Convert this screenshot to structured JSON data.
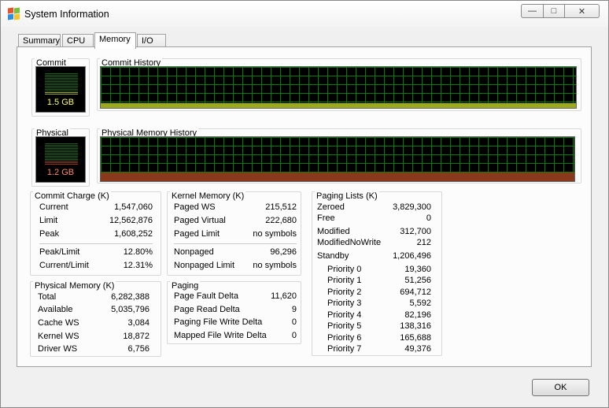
{
  "window": {
    "title": "System Information",
    "controls": {
      "minimize": "—",
      "maximize": "□",
      "close": "✕"
    }
  },
  "tabs": [
    {
      "label": "Summary"
    },
    {
      "label": "CPU"
    },
    {
      "label": "Memory",
      "active": true
    },
    {
      "label": "I/O"
    }
  ],
  "commit": {
    "title": "Commit",
    "value": "1.5 GB",
    "history_title": "Commit History",
    "usage_fraction": 0.12
  },
  "physical": {
    "title": "Physical",
    "value": "1.2 GB",
    "history_title": "Physical Memory History",
    "usage_fraction": 0.19
  },
  "commit_charge": {
    "title": "Commit Charge (K)",
    "rows": [
      {
        "label": "Current",
        "value": "1,547,060"
      },
      {
        "label": "Limit",
        "value": "12,562,876"
      },
      {
        "label": "Peak",
        "value": "1,608,252"
      },
      {
        "label": "Peak/Limit",
        "value": "12.80%"
      },
      {
        "label": "Current/Limit",
        "value": "12.31%"
      }
    ]
  },
  "physical_memory": {
    "title": "Physical Memory (K)",
    "rows": [
      {
        "label": "Total",
        "value": "6,282,388"
      },
      {
        "label": "Available",
        "value": "5,035,796"
      },
      {
        "label": "Cache WS",
        "value": "3,084"
      },
      {
        "label": "Kernel WS",
        "value": "18,872"
      },
      {
        "label": "Driver WS",
        "value": "6,756"
      }
    ]
  },
  "kernel_memory": {
    "title": "Kernel Memory (K)",
    "rows": [
      {
        "label": "Paged WS",
        "value": "215,512"
      },
      {
        "label": "Paged Virtual",
        "value": "222,680"
      },
      {
        "label": "Paged Limit",
        "value": "no symbols"
      },
      {
        "label": "Nonpaged",
        "value": "96,296"
      },
      {
        "label": "Nonpaged Limit",
        "value": "no symbols"
      }
    ]
  },
  "paging": {
    "title": "Paging",
    "rows": [
      {
        "label": "Page Fault Delta",
        "value": "11,620"
      },
      {
        "label": "Page Read Delta",
        "value": "9"
      },
      {
        "label": "Paging File Write Delta",
        "value": "0"
      },
      {
        "label": "Mapped File Write Delta",
        "value": "0"
      }
    ]
  },
  "paging_lists": {
    "title": "Paging Lists (K)",
    "rows": [
      {
        "label": "Zeroed",
        "value": "3,829,300"
      },
      {
        "label": "Free",
        "value": "0"
      },
      {
        "label": "Modified",
        "value": "312,700"
      },
      {
        "label": "ModifiedNoWrite",
        "value": "212"
      },
      {
        "label": "Standby",
        "value": "1,206,496"
      }
    ],
    "priorities": [
      {
        "label": "Priority 0",
        "value": "19,360"
      },
      {
        "label": "Priority 1",
        "value": "51,256"
      },
      {
        "label": "Priority 2",
        "value": "694,712"
      },
      {
        "label": "Priority 3",
        "value": "5,592"
      },
      {
        "label": "Priority 4",
        "value": "82,196"
      },
      {
        "label": "Priority 5",
        "value": "138,316"
      },
      {
        "label": "Priority 6",
        "value": "165,688"
      },
      {
        "label": "Priority 7",
        "value": "49,376"
      }
    ]
  },
  "buttons": {
    "ok": "OK"
  },
  "colors": {
    "commit_fill": "#9aaa1c",
    "commit_text": "#ffff66",
    "physical_fill": "#8a3a1c",
    "physical_text": "#ff8866",
    "grid": "#0a7a0a"
  }
}
